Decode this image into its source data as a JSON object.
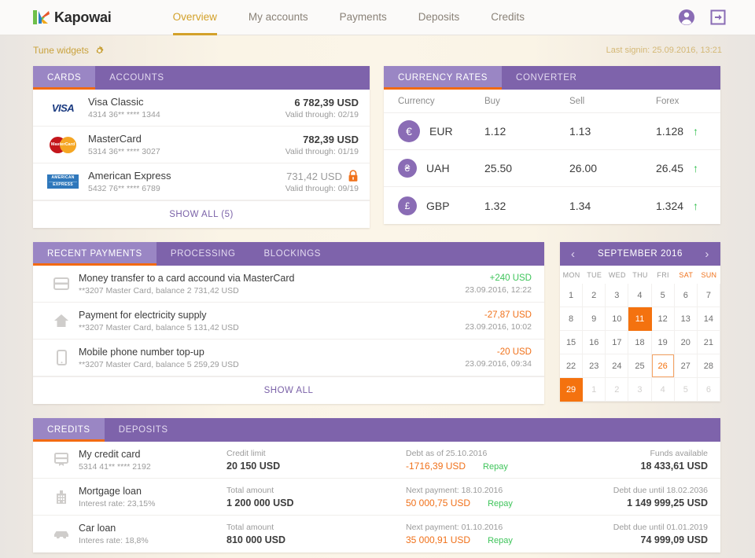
{
  "brand": {
    "name": "Kapowai"
  },
  "nav": {
    "items": [
      {
        "label": "Overview",
        "active": true
      },
      {
        "label": "My accounts",
        "active": false
      },
      {
        "label": "Payments",
        "active": false
      },
      {
        "label": "Deposits",
        "active": false
      },
      {
        "label": "Credits",
        "active": false
      }
    ],
    "account_icon": "account-circle-icon",
    "logout_icon": "logout-icon"
  },
  "subhead": {
    "tune_label": "Tune widgets",
    "tune_icon": "gear-icon",
    "last_signin": "Last signin: 25.09.2016, 13:21"
  },
  "cards_widget": {
    "tabs": [
      {
        "label": "CARDS",
        "active": true
      },
      {
        "label": "ACCOUNTS",
        "active": false
      }
    ],
    "rows": [
      {
        "brand": "visa",
        "name": "Visa Classic",
        "number": "4314 36** **** 1344",
        "amount": "6 782,39 USD",
        "valid": "Valid through: 02/19",
        "locked": false
      },
      {
        "brand": "mastercard",
        "name": "MasterCard",
        "number": "5314 36** **** 3027",
        "amount": "782,39 USD",
        "valid": "Valid through: 01/19",
        "locked": false
      },
      {
        "brand": "amex",
        "name": "American Express",
        "number": "5432 76** **** 6789",
        "amount": "731,42 USD",
        "valid": "Valid through: 09/19",
        "locked": true
      }
    ],
    "show_all": "SHOW ALL (5)"
  },
  "currency_widget": {
    "tabs": [
      {
        "label": "CURRENCY RATES",
        "active": true
      },
      {
        "label": "CONVERTER",
        "active": false
      }
    ],
    "headers": {
      "currency": "Currency",
      "buy": "Buy",
      "sell": "Sell",
      "forex": "Forex"
    },
    "rows": [
      {
        "symbol": "€",
        "code": "EUR",
        "buy": "1.12",
        "sell": "1.13",
        "forex": "1.128",
        "trend": "up"
      },
      {
        "symbol": "₴",
        "code": "UAH",
        "buy": "25.50",
        "sell": "26.00",
        "forex": "26.45",
        "trend": "up"
      },
      {
        "symbol": "£",
        "code": "GBP",
        "buy": "1.32",
        "sell": "1.34",
        "forex": "1.324",
        "trend": "up"
      }
    ]
  },
  "payments_widget": {
    "tabs": [
      {
        "label": "RECENT PAYMENTS",
        "active": true
      },
      {
        "label": "PROCESSING",
        "active": false
      },
      {
        "label": "BLOCKINGS",
        "active": false
      }
    ],
    "rows": [
      {
        "icon": "credit-card-icon",
        "title": "Money transfer to a card accound via MasterCard",
        "sub": "**3207 Master Card, balance 2 731,42 USD",
        "amount": "+240 USD",
        "sign": "pos",
        "date": "23.09.2016, 12:22"
      },
      {
        "icon": "home-icon",
        "title": "Payment for electricity supply",
        "sub": "**3207 Master Card, balance 5 131,42 USD",
        "amount": "-27,87 USD",
        "sign": "neg",
        "date": "23.09.2016, 10:02"
      },
      {
        "icon": "mobile-phone-icon",
        "title": "Mobile phone number top-up",
        "sub": "**3207 Master Card, balance 5 259,29 USD",
        "amount": "-20 USD",
        "sign": "neg",
        "date": "23.09.2016, 09:34"
      }
    ],
    "show_all": "SHOW ALL"
  },
  "calendar": {
    "title": "SEPTEMBER 2016",
    "prev_icon": "chevron-left-icon",
    "next_icon": "chevron-right-icon",
    "dow": [
      "MON",
      "TUE",
      "WED",
      "THU",
      "FRI",
      "SAT",
      "SUN"
    ],
    "weekend_index": [
      5,
      6
    ],
    "weeks": [
      [
        {
          "d": "1"
        },
        {
          "d": "2"
        },
        {
          "d": "3"
        },
        {
          "d": "4"
        },
        {
          "d": "5"
        },
        {
          "d": "6"
        },
        {
          "d": "7"
        }
      ],
      [
        {
          "d": "8"
        },
        {
          "d": "9"
        },
        {
          "d": "10"
        },
        {
          "d": "11",
          "state": "sel"
        },
        {
          "d": "12"
        },
        {
          "d": "13"
        },
        {
          "d": "14"
        }
      ],
      [
        {
          "d": "15"
        },
        {
          "d": "16"
        },
        {
          "d": "17"
        },
        {
          "d": "18"
        },
        {
          "d": "19"
        },
        {
          "d": "20"
        },
        {
          "d": "21"
        }
      ],
      [
        {
          "d": "22"
        },
        {
          "d": "23"
        },
        {
          "d": "24"
        },
        {
          "d": "25"
        },
        {
          "d": "26",
          "state": "today"
        },
        {
          "d": "27"
        },
        {
          "d": "28"
        }
      ],
      [
        {
          "d": "29",
          "state": "sel"
        },
        {
          "d": "1",
          "state": "out"
        },
        {
          "d": "2",
          "state": "out"
        },
        {
          "d": "3",
          "state": "out"
        },
        {
          "d": "4",
          "state": "out"
        },
        {
          "d": "5",
          "state": "out"
        },
        {
          "d": "6",
          "state": "out"
        }
      ]
    ]
  },
  "credits_widget": {
    "tabs": [
      {
        "label": "CREDITS",
        "active": true
      },
      {
        "label": "DEPOSITS",
        "active": false
      }
    ],
    "rows": [
      {
        "icon": "credit-card-icon",
        "title": "My credit card",
        "sub": "5314 41** **** 2192",
        "col_label": "Credit limit",
        "col_value": "20 150 USD",
        "mid_label": "Debt as of 25.10.2016",
        "mid_value": "-1716,39 USD",
        "repay": "Repay",
        "right_label": "Funds available",
        "right_value": "18 433,61 USD"
      },
      {
        "icon": "building-icon",
        "title": "Mortgage loan",
        "sub": "Interest rate: 23,15%",
        "col_label": "Total amount",
        "col_value": "1 200 000 USD",
        "mid_label": "Next payment: 18.10.2016",
        "mid_value": "50 000,75 USD",
        "repay": "Repay",
        "right_label": "Debt due until 18.02.2036",
        "right_value": "1 149 999,25 USD"
      },
      {
        "icon": "car-icon",
        "title": "Car loan",
        "sub": "Interes rate: 18,8%",
        "col_label": "Total amount",
        "col_value": "810 000 USD",
        "mid_label": "Next payment: 01.10.2016",
        "mid_value": "35 000,91 USD",
        "repay": "Repay",
        "right_label": "Debt due until 01.01.2019",
        "right_value": "74 999,09 USD"
      }
    ]
  },
  "colors": {
    "purple_dark": "#7e63ab",
    "purple_light": "#9a86c4",
    "orange": "#f26a12",
    "gold": "#d3a12a",
    "green": "#3ec45a"
  }
}
